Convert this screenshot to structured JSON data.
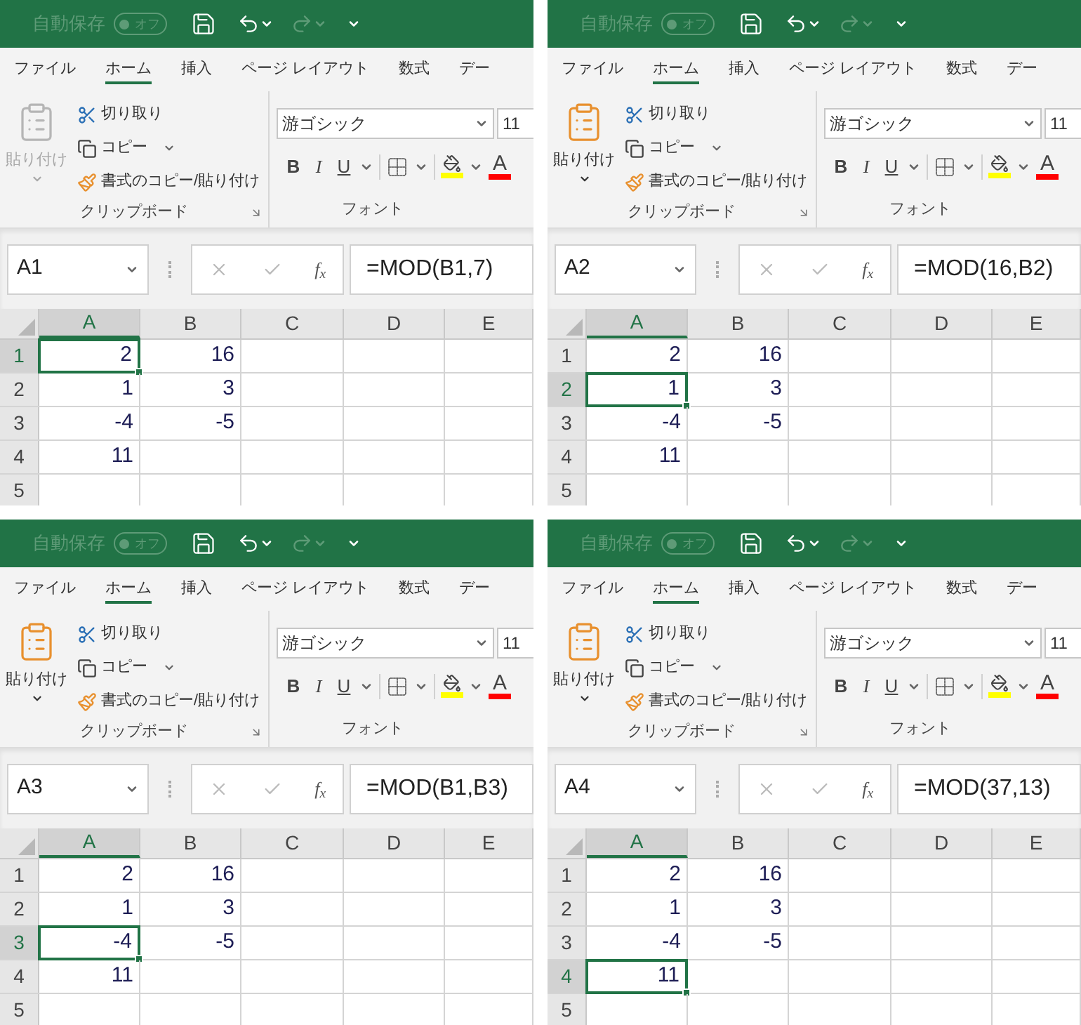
{
  "panels": [
    {
      "autosave": {
        "label": "自動保存",
        "toggle": "オフ"
      },
      "tabs": [
        {
          "label": "ファイル",
          "selected": false
        },
        {
          "label": "ホーム",
          "selected": true
        },
        {
          "label": "挿入",
          "selected": false
        },
        {
          "label": "ページ レイアウト",
          "selected": false
        },
        {
          "label": "数式",
          "selected": false
        },
        {
          "label": "デー",
          "selected": false
        }
      ],
      "clipboard": {
        "paste": "貼り付け",
        "paste_disabled": true,
        "cut": "切り取り",
        "copy": "コピー",
        "format_painter": "書式のコピー/貼り付け",
        "group_label": "クリップボード"
      },
      "font": {
        "name": "游ゴシック",
        "size": "11",
        "bold": "B",
        "italic": "I",
        "underline": "U",
        "font_color": "A",
        "group_label": "フォント"
      },
      "formula_bar": {
        "name_box": "A1",
        "fx": "f$_{x}$",
        "formula": "=MOD(B1,7)"
      },
      "grid": {
        "columns": [
          {
            "label": "A",
            "selected": true
          },
          {
            "label": "B",
            "selected": false
          },
          {
            "label": "C",
            "selected": false
          },
          {
            "label": "D",
            "selected": false
          },
          {
            "label": "E",
            "selected": false
          }
        ],
        "rows": [
          {
            "label": "1",
            "selected": true,
            "cells": [
              {
                "value": "2",
                "selected": true
              },
              {
                "value": "16",
                "selected": false
              }
            ]
          },
          {
            "label": "2",
            "selected": false,
            "cells": [
              {
                "value": "1",
                "selected": false
              },
              {
                "value": "3",
                "selected": false
              }
            ]
          },
          {
            "label": "3",
            "selected": false,
            "cells": [
              {
                "value": "-4",
                "selected": false
              },
              {
                "value": "-5",
                "selected": false
              }
            ]
          },
          {
            "label": "4",
            "selected": false,
            "cells": [
              {
                "value": "11",
                "selected": false
              }
            ]
          },
          {
            "label": "5",
            "selected": false
          }
        ]
      }
    },
    {
      "autosave": {
        "label": "自動保存",
        "toggle": "オフ"
      },
      "tabs": [
        {
          "label": "ファイル",
          "selected": false
        },
        {
          "label": "ホーム",
          "selected": true
        },
        {
          "label": "挿入",
          "selected": false
        },
        {
          "label": "ページ レイアウト",
          "selected": false
        },
        {
          "label": "数式",
          "selected": false
        },
        {
          "label": "デー",
          "selected": false
        }
      ],
      "clipboard": {
        "paste": "貼り付け",
        "paste_disabled": false,
        "cut": "切り取り",
        "copy": "コピー",
        "format_painter": "書式のコピー/貼り付け",
        "group_label": "クリップボード"
      },
      "font": {
        "name": "游ゴシック",
        "size": "11",
        "bold": "B",
        "italic": "I",
        "underline": "U",
        "font_color": "A",
        "group_label": "フォント"
      },
      "formula_bar": {
        "name_box": "A2",
        "fx": "f$_{x}$",
        "formula": "=MOD(16,B2)"
      },
      "grid": {
        "columns": [
          {
            "label": "A",
            "selected": true
          },
          {
            "label": "B",
            "selected": false
          },
          {
            "label": "C",
            "selected": false
          },
          {
            "label": "D",
            "selected": false
          },
          {
            "label": "E",
            "selected": false
          }
        ],
        "rows": [
          {
            "label": "1",
            "selected": false,
            "cells": [
              {
                "value": "2",
                "selected": false
              },
              {
                "value": "16",
                "selected": false
              }
            ]
          },
          {
            "label": "2",
            "selected": true,
            "cells": [
              {
                "value": "1",
                "selected": true
              },
              {
                "value": "3",
                "selected": false
              }
            ]
          },
          {
            "label": "3",
            "selected": false,
            "cells": [
              {
                "value": "-4",
                "selected": false
              },
              {
                "value": "-5",
                "selected": false
              }
            ]
          },
          {
            "label": "4",
            "selected": false,
            "cells": [
              {
                "value": "11",
                "selected": false
              }
            ]
          },
          {
            "label": "5",
            "selected": false
          }
        ]
      }
    },
    {
      "autosave": {
        "label": "自動保存",
        "toggle": "オフ"
      },
      "tabs": [
        {
          "label": "ファイル",
          "selected": false
        },
        {
          "label": "ホーム",
          "selected": true
        },
        {
          "label": "挿入",
          "selected": false
        },
        {
          "label": "ページ レイアウト",
          "selected": false
        },
        {
          "label": "数式",
          "selected": false
        },
        {
          "label": "デー",
          "selected": false
        }
      ],
      "clipboard": {
        "paste": "貼り付け",
        "paste_disabled": false,
        "cut": "切り取り",
        "copy": "コピー",
        "format_painter": "書式のコピー/貼り付け",
        "group_label": "クリップボード"
      },
      "font": {
        "name": "游ゴシック",
        "size": "11",
        "bold": "B",
        "italic": "I",
        "underline": "U",
        "font_color": "A",
        "group_label": "フォント"
      },
      "formula_bar": {
        "name_box": "A3",
        "fx": "f$_{x}$",
        "formula": "=MOD(B1,B3)"
      },
      "grid": {
        "columns": [
          {
            "label": "A",
            "selected": true
          },
          {
            "label": "B",
            "selected": false
          },
          {
            "label": "C",
            "selected": false
          },
          {
            "label": "D",
            "selected": false
          },
          {
            "label": "E",
            "selected": false
          }
        ],
        "rows": [
          {
            "label": "1",
            "selected": false,
            "cells": [
              {
                "value": "2",
                "selected": false
              },
              {
                "value": "16",
                "selected": false
              }
            ]
          },
          {
            "label": "2",
            "selected": false,
            "cells": [
              {
                "value": "1",
                "selected": false
              },
              {
                "value": "3",
                "selected": false
              }
            ]
          },
          {
            "label": "3",
            "selected": true,
            "cells": [
              {
                "value": "-4",
                "selected": true
              },
              {
                "value": "-5",
                "selected": false
              }
            ]
          },
          {
            "label": "4",
            "selected": false,
            "cells": [
              {
                "value": "11",
                "selected": false
              }
            ]
          },
          {
            "label": "5",
            "selected": false
          }
        ]
      }
    },
    {
      "autosave": {
        "label": "自動保存",
        "toggle": "オフ"
      },
      "tabs": [
        {
          "label": "ファイル",
          "selected": false
        },
        {
          "label": "ホーム",
          "selected": true
        },
        {
          "label": "挿入",
          "selected": false
        },
        {
          "label": "ページ レイアウト",
          "selected": false
        },
        {
          "label": "数式",
          "selected": false
        },
        {
          "label": "デー",
          "selected": false
        }
      ],
      "clipboard": {
        "paste": "貼り付け",
        "paste_disabled": false,
        "cut": "切り取り",
        "copy": "コピー",
        "format_painter": "書式のコピー/貼り付け",
        "group_label": "クリップボード"
      },
      "font": {
        "name": "游ゴシック",
        "size": "11",
        "bold": "B",
        "italic": "I",
        "underline": "U",
        "font_color": "A",
        "group_label": "フォント"
      },
      "formula_bar": {
        "name_box": "A4",
        "fx": "f$_{x}$",
        "formula": "=MOD(37,13)"
      },
      "grid": {
        "columns": [
          {
            "label": "A",
            "selected": true
          },
          {
            "label": "B",
            "selected": false
          },
          {
            "label": "C",
            "selected": false
          },
          {
            "label": "D",
            "selected": false
          },
          {
            "label": "E",
            "selected": false
          }
        ],
        "rows": [
          {
            "label": "1",
            "selected": false,
            "cells": [
              {
                "value": "2",
                "selected": false
              },
              {
                "value": "16",
                "selected": false
              }
            ]
          },
          {
            "label": "2",
            "selected": false,
            "cells": [
              {
                "value": "1",
                "selected": false
              },
              {
                "value": "3",
                "selected": false
              }
            ]
          },
          {
            "label": "3",
            "selected": false,
            "cells": [
              {
                "value": "-4",
                "selected": false
              },
              {
                "value": "-5",
                "selected": false
              }
            ]
          },
          {
            "label": "4",
            "selected": true,
            "cells": [
              {
                "value": "11",
                "selected": true
              }
            ]
          },
          {
            "label": "5",
            "selected": false
          }
        ]
      }
    }
  ]
}
